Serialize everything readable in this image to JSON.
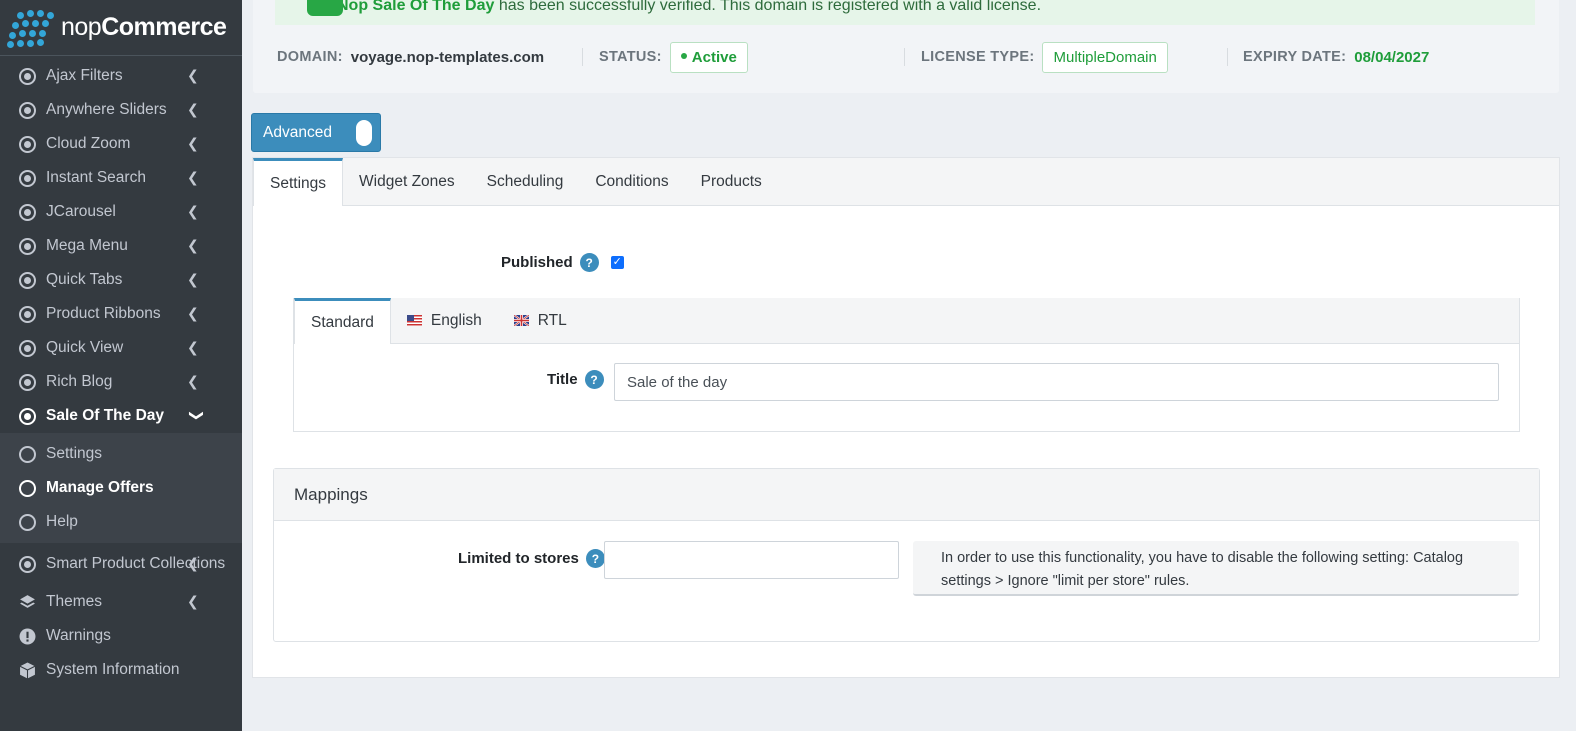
{
  "brand": {
    "name_light": "nop",
    "name_bold": "Commerce"
  },
  "sidebar": {
    "items": [
      {
        "label": "Ajax Filters"
      },
      {
        "label": "Anywhere Sliders"
      },
      {
        "label": "Cloud Zoom"
      },
      {
        "label": "Instant Search"
      },
      {
        "label": "JCarousel"
      },
      {
        "label": "Mega Menu"
      },
      {
        "label": "Quick Tabs"
      },
      {
        "label": "Product Ribbons"
      },
      {
        "label": "Quick View"
      },
      {
        "label": "Rich Blog"
      },
      {
        "label": "Sale Of The Day"
      }
    ],
    "subitems": [
      {
        "label": "Settings"
      },
      {
        "label": "Manage Offers"
      },
      {
        "label": "Help"
      }
    ],
    "after": [
      {
        "label": "Smart Product Collections"
      },
      {
        "label": "Themes"
      },
      {
        "label": "Warnings"
      },
      {
        "label": "System Information"
      }
    ]
  },
  "license": {
    "alert_bold": "Nop Sale Of The Day",
    "alert_rest": " has been successfully verified. This domain is registered with a valid license.",
    "domain_key": "DOMAIN:",
    "domain_val": "voyage.nop-templates.com",
    "status_key": "STATUS:",
    "status_val": "Active",
    "type_key": "LICENSE TYPE:",
    "type_val": "MultipleDomain",
    "expiry_key": "EXPIRY DATE:",
    "expiry_val": "08/04/2027"
  },
  "advanced_toggle": {
    "label": "Advanced"
  },
  "tabs": [
    "Settings",
    "Widget Zones",
    "Scheduling",
    "Conditions",
    "Products"
  ],
  "form": {
    "published_label": "Published",
    "help_glyph": "?",
    "lang_tabs": [
      "Standard",
      "English",
      "RTL"
    ],
    "title_label": "Title",
    "title_value": "Sale of the day"
  },
  "mappings": {
    "heading": "Mappings",
    "stores_label": "Limited to stores",
    "stores_value": "",
    "callout": "In order to use this functionality, you have to disable the following setting: Catalog settings > Ignore \"limit per store\" rules."
  },
  "colors": {
    "sidebar_bg": "#343a40",
    "accent": "#3c8dbc",
    "success": "#28a745"
  }
}
